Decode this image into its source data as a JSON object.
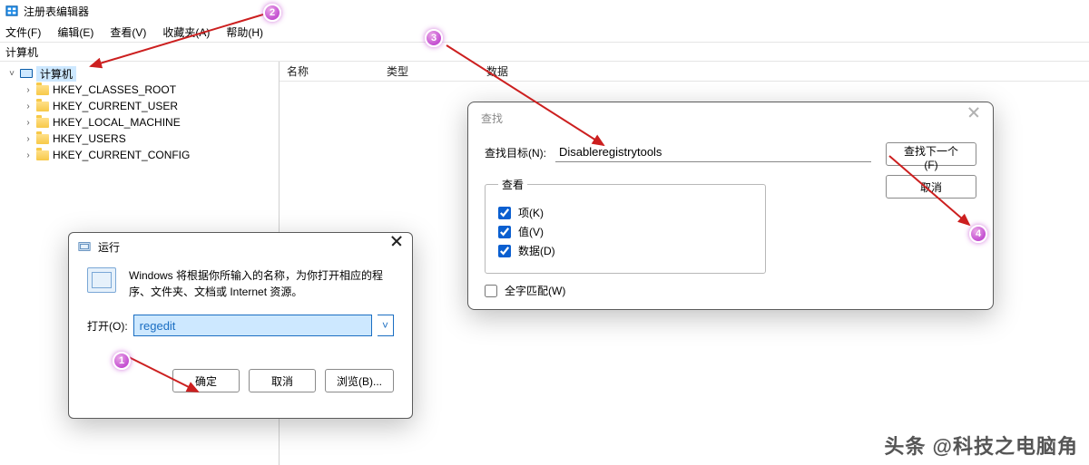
{
  "app": {
    "title": "注册表编辑器"
  },
  "menu": {
    "file": "文件(F)",
    "edit": "编辑(E)",
    "view": "查看(V)",
    "fav": "收藏夹(A)",
    "help": "帮助(H)"
  },
  "addr": "计算机",
  "tree": {
    "root": "计算机",
    "items": [
      "HKEY_CLASSES_ROOT",
      "HKEY_CURRENT_USER",
      "HKEY_LOCAL_MACHINE",
      "HKEY_USERS",
      "HKEY_CURRENT_CONFIG"
    ]
  },
  "cols": {
    "name": "名称",
    "type": "类型",
    "data": "数据"
  },
  "run": {
    "title": "运行",
    "desc": "Windows 将根据你所输入的名称，为你打开相应的程序、文件夹、文档或 Internet 资源。",
    "open_label": "打开(O):",
    "value": "regedit",
    "ok": "确定",
    "cancel": "取消",
    "browse": "浏览(B)..."
  },
  "find": {
    "title": "查找",
    "target_label": "查找目标(N):",
    "target_value": "Disableregistrytools",
    "group": "查看",
    "keys": "项(K)",
    "values": "值(V)",
    "data": "数据(D)",
    "match": "全字匹配(W)",
    "next": "查找下一个(F)",
    "cancel": "取消"
  },
  "markers": {
    "m1": "1",
    "m2": "2",
    "m3": "3",
    "m4": "4"
  },
  "watermark": "头条 @科技之电脑角"
}
